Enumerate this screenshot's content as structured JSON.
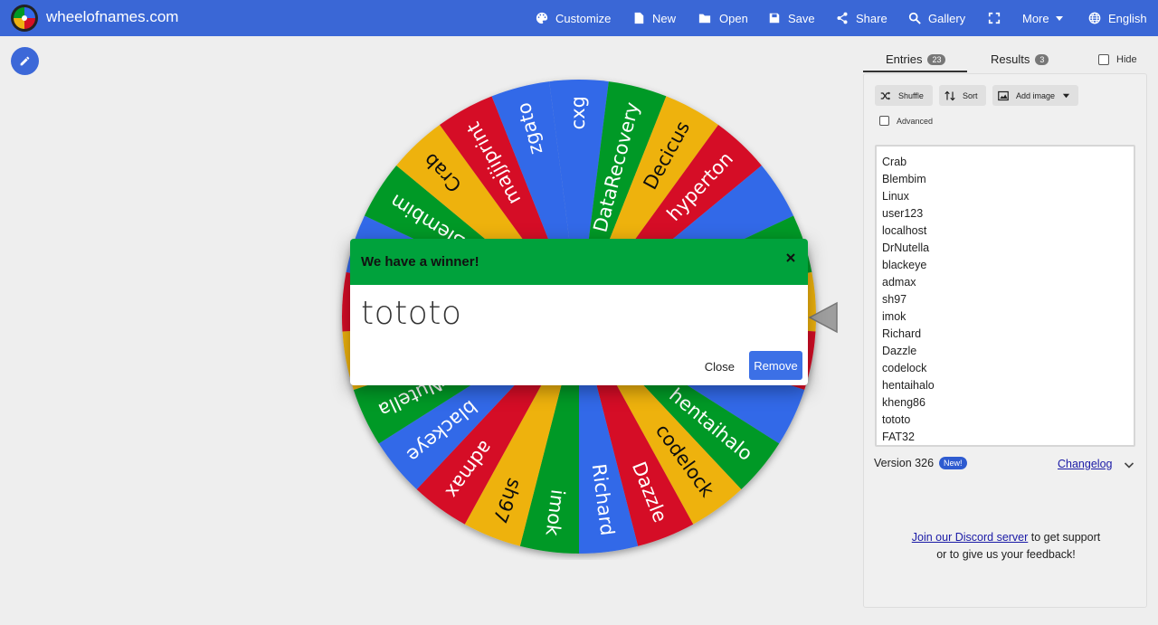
{
  "app": {
    "site_title": "wheelofnames.com"
  },
  "nav": {
    "customize": "Customize",
    "new": "New",
    "open": "Open",
    "save": "Save",
    "share": "Share",
    "gallery": "Gallery",
    "more": "More",
    "language": "English"
  },
  "wheel": {
    "segments": [
      "cxg",
      "DataRecovery",
      "Decicus",
      "hyperton",
      "",
      "",
      "",
      "",
      "",
      "hentaihalo",
      "codelock",
      "Dazzle",
      "Richard",
      "imok",
      "sh97",
      "admax",
      "blackeye",
      "DrNutella",
      "",
      "",
      "",
      "Blembim",
      "Crab",
      "majjiprint",
      "zgato"
    ],
    "colors": {
      "blue": "#3369e8",
      "green": "#009925",
      "yellow": "#eeb211",
      "red": "#d50f25"
    }
  },
  "modal": {
    "title": "We have a winner!",
    "winner": "tototo",
    "close_label": "Close",
    "remove_label": "Remove"
  },
  "panel": {
    "tabs": {
      "entries_label": "Entries",
      "entries_count": "23",
      "results_label": "Results",
      "results_count": "3"
    },
    "hide_label": "Hide",
    "toolbar": {
      "shuffle": "Shuffle",
      "sort": "Sort",
      "add_image": "Add image"
    },
    "advanced_label": "Advanced",
    "entries": [
      "Crab",
      "Blembim",
      "Linux",
      "user123",
      "localhost",
      "DrNutella",
      "blackeye",
      "admax",
      "sh97",
      "imok",
      "Richard",
      "Dazzle",
      "codelock",
      "hentaihalo",
      "kheng86",
      "tototo",
      "FAT32"
    ],
    "version": "Version 326",
    "new_badge": "New!",
    "changelog": "Changelog",
    "discord_link": "Join our Discord server",
    "discord_rest1": " to get support",
    "discord_rest2": "or to give us your feedback!"
  }
}
